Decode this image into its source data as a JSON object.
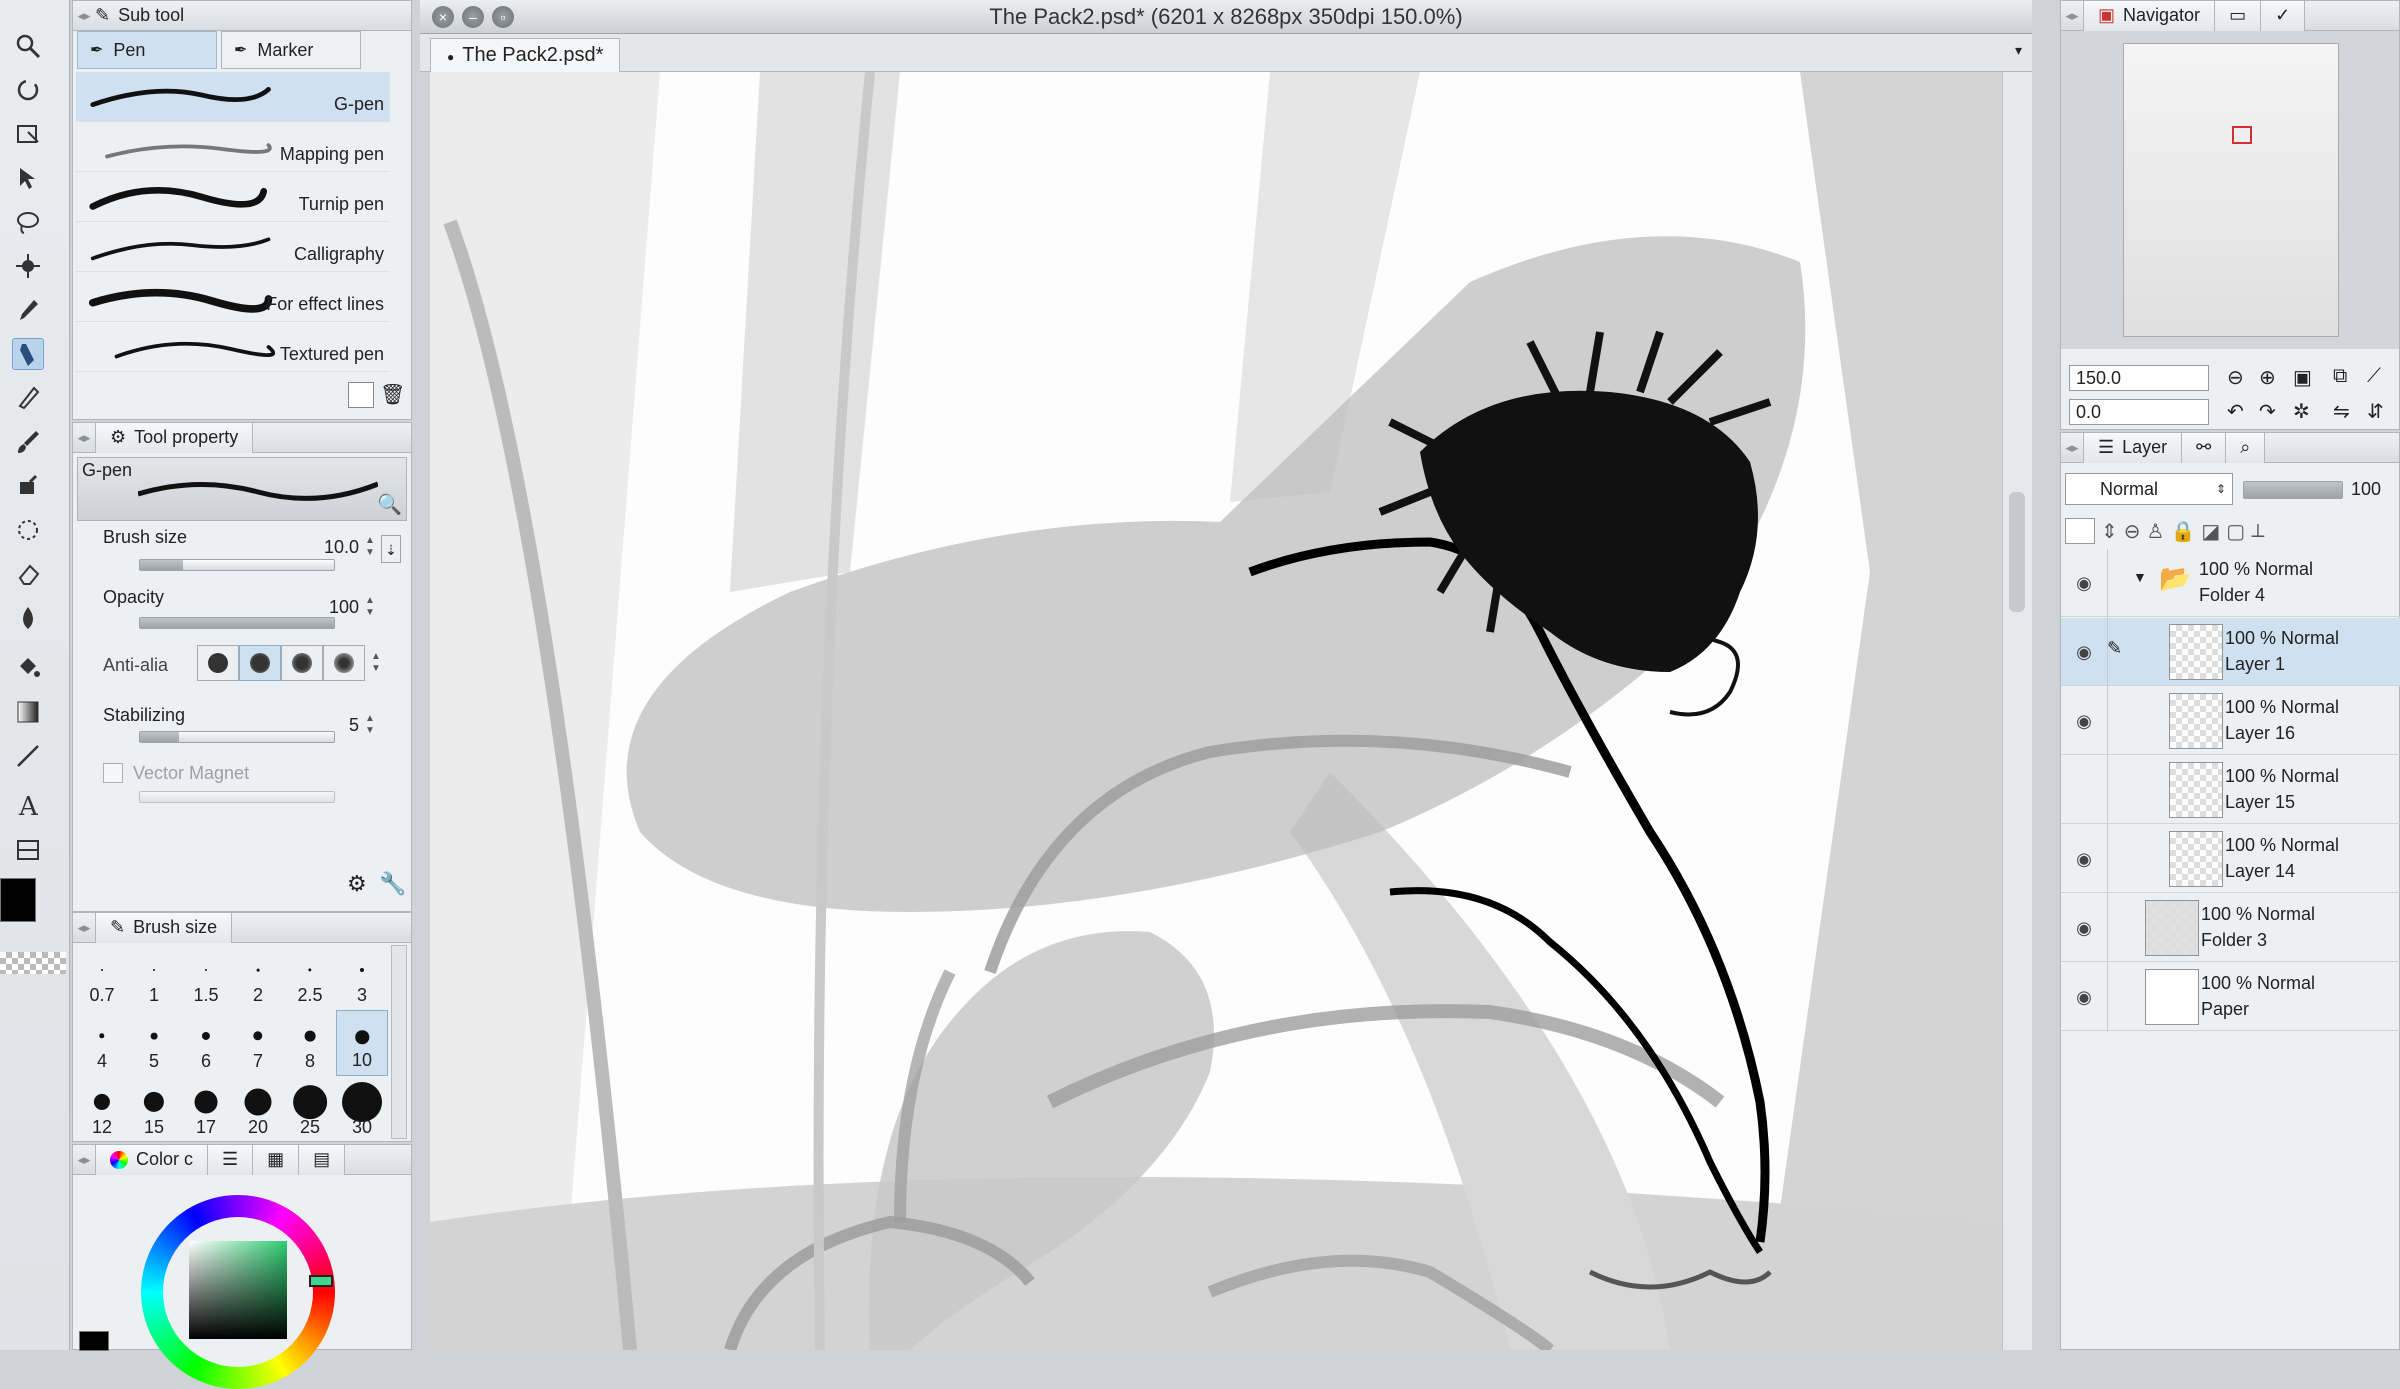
{
  "window": {
    "title": "The Pack2.psd* (6201 x 8268px 350dpi 150.0%)"
  },
  "document_tab": {
    "label": "The Pack2.psd*"
  },
  "sub_tool": {
    "title": "Sub tool",
    "tabs": [
      {
        "label": "Pen"
      },
      {
        "label": "Marker"
      }
    ],
    "brushes": [
      {
        "label": "G-pen",
        "selected": true
      },
      {
        "label": "Mapping pen"
      },
      {
        "label": "Turnip pen"
      },
      {
        "label": "Calligraphy"
      },
      {
        "label": "For effect lines"
      },
      {
        "label": "Textured pen"
      }
    ]
  },
  "tool_property": {
    "title": "Tool property",
    "preset_name": "G-pen",
    "brush_size": {
      "label": "Brush size",
      "value": "10.0"
    },
    "opacity": {
      "label": "Opacity",
      "value": "100"
    },
    "anti_alias": {
      "label": "Anti-alia"
    },
    "stabilizing": {
      "label": "Stabilizing",
      "value": "5"
    },
    "vector_magnet": {
      "label": "Vector Magnet",
      "checked": false
    }
  },
  "brush_size_panel": {
    "title": "Brush size",
    "sizes": [
      "0.7",
      "1",
      "1.5",
      "2",
      "2.5",
      "3",
      "4",
      "5",
      "6",
      "7",
      "8",
      "10",
      "12",
      "15",
      "17",
      "20",
      "25",
      "30"
    ],
    "selected": "10"
  },
  "color_panel": {
    "title": "Color c"
  },
  "navigator": {
    "title": "Navigator",
    "zoom": "150.0",
    "rotation": "0.0"
  },
  "layer_panel": {
    "title": "Layer",
    "blend_mode": "Normal",
    "opacity": "100",
    "layers": [
      {
        "line1": "100 % Normal",
        "line2": "Folder 4",
        "visible": true,
        "type": "folder",
        "indent": 0,
        "selected": false
      },
      {
        "line1": "100 % Normal",
        "line2": "Layer 1",
        "visible": true,
        "type": "raster",
        "indent": 1,
        "selected": true
      },
      {
        "line1": "100 % Normal",
        "line2": "Layer 16",
        "visible": true,
        "type": "raster",
        "indent": 1,
        "selected": false
      },
      {
        "line1": "100 % Normal",
        "line2": "Layer 15",
        "visible": false,
        "type": "raster",
        "indent": 1,
        "selected": false
      },
      {
        "line1": "100 % Normal",
        "line2": "Layer 14",
        "visible": true,
        "type": "raster",
        "indent": 1,
        "selected": false
      },
      {
        "line1": "100 % Normal",
        "line2": "Folder 3",
        "visible": true,
        "type": "folder-thumb",
        "indent": 0,
        "selected": false
      },
      {
        "line1": "100 % Normal",
        "line2": "Paper",
        "visible": true,
        "type": "paper",
        "indent": 0,
        "selected": false
      }
    ]
  },
  "colors": {
    "accent": "#cfe0f1",
    "main_color": "#000000"
  }
}
